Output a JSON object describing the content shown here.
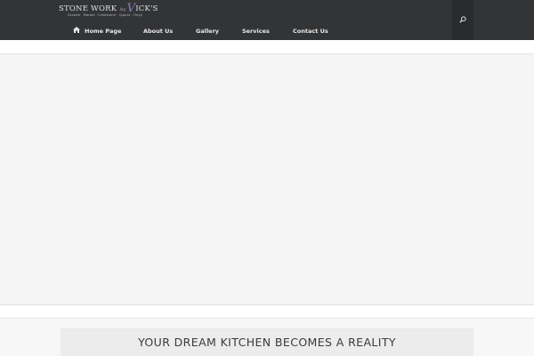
{
  "header": {
    "logo": {
      "main_left": "STONE WORK",
      "by": "by",
      "brand_initial": "V",
      "brand_rest": "ICK'S",
      "tagline": "Granite · Marble · Limestone · Quartz · Onyx"
    },
    "search_icon": "search-icon",
    "nav": {
      "home_icon": "home-icon",
      "items": [
        {
          "label": "Home Page"
        },
        {
          "label": "About Us"
        },
        {
          "label": "Gallery"
        },
        {
          "label": "Services"
        },
        {
          "label": "Contact Us"
        }
      ]
    },
    "colors": {
      "header_bg": "#333436",
      "accent": "#8b7fc4"
    }
  },
  "banner": {
    "title": "YOUR DREAM KITCHEN BECOMES A REALITY"
  }
}
